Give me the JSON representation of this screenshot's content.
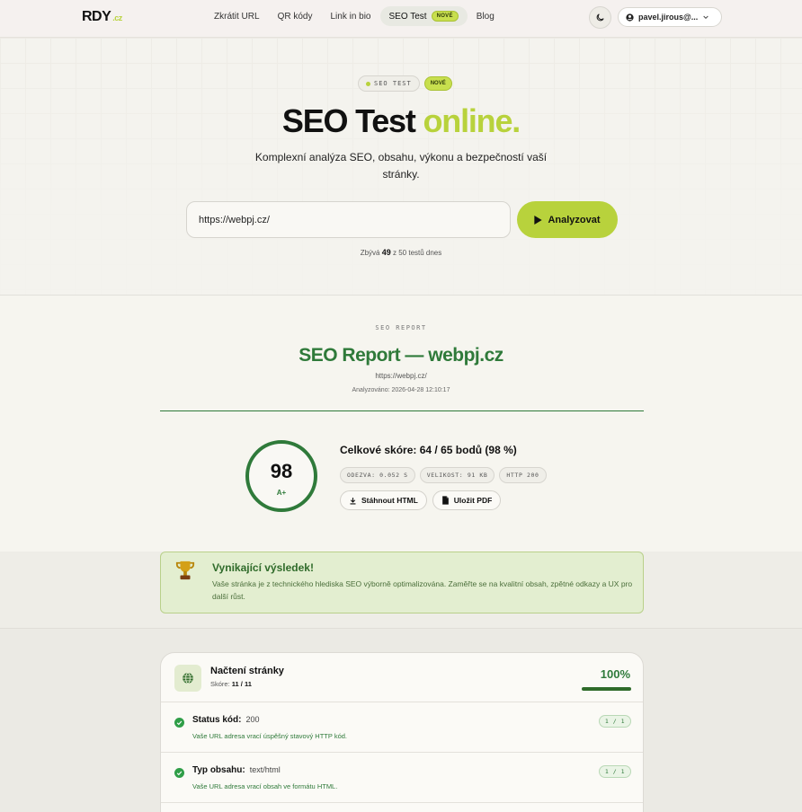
{
  "nav": {
    "logo": "RDY",
    "logo_tld": ".cz",
    "links": [
      {
        "label": "Zkrátit URL"
      },
      {
        "label": "QR kódy"
      },
      {
        "label": "Link in bio"
      },
      {
        "label": "SEO Test",
        "badge": "NOVÉ",
        "active": true
      },
      {
        "label": "Blog"
      }
    ],
    "theme_icon": "moon-icon",
    "user": "pavel.jirous@..."
  },
  "hero": {
    "pill_label": "SEO TEST",
    "pill_badge": "NOVÉ",
    "title_main": "SEO Test",
    "title_accent": "online.",
    "subtitle": "Komplexní analýza SEO, obsahu, výkonu a bezpečností vaší stránky.",
    "url_value": "https://webpj.cz/",
    "analyze_label": "Analyzovat",
    "quota_prefix": "Zbývá",
    "quota_count": "49",
    "quota_suffix": "z 50 testů dnes"
  },
  "report": {
    "kicker": "SEO REPORT",
    "title": "SEO Report — webpj.cz",
    "url": "https://webpj.cz/",
    "analyzed": "Analyzováno: 2026-04-28 12:10:17",
    "score": "98",
    "grade": "A+",
    "total_label": "Celkové skóre:",
    "total_value": "64 / 65",
    "total_suffix": "bodů (98 %)",
    "chips": [
      "ODEZVA: 0.052 S",
      "VELIKOST: 91 KB",
      "HTTP 200"
    ],
    "download_html": "Stáhnout HTML",
    "save_pdf": "Uložit PDF"
  },
  "verdict": {
    "title": "Vynikající výsledek!",
    "text": "Vaše stránka je z technického hlediska SEO výborně optimalizována. Zaměřte se na kvalitní obsah, zpětné odkazy a UX pro další růst."
  },
  "section": {
    "title": "Načtení stránky",
    "score_label": "Skóre:",
    "score_value": "11 / 11",
    "percent": "100%",
    "progress": 1.0,
    "rows": [
      {
        "label": "Status kód:",
        "value": "200",
        "desc": "Vaše URL adresa vrací úspěšný stavový HTTP kód.",
        "points": "1 / 1"
      },
      {
        "label": "Typ obsahu:",
        "value": "text/html",
        "desc": "Vaše URL adresa vrací obsah ve formátu HTML.",
        "points": "1 / 1"
      }
    ]
  },
  "colors": {
    "accent": "#b8d23c",
    "success": "#2f7a3a",
    "background": "#f6f5ef"
  }
}
